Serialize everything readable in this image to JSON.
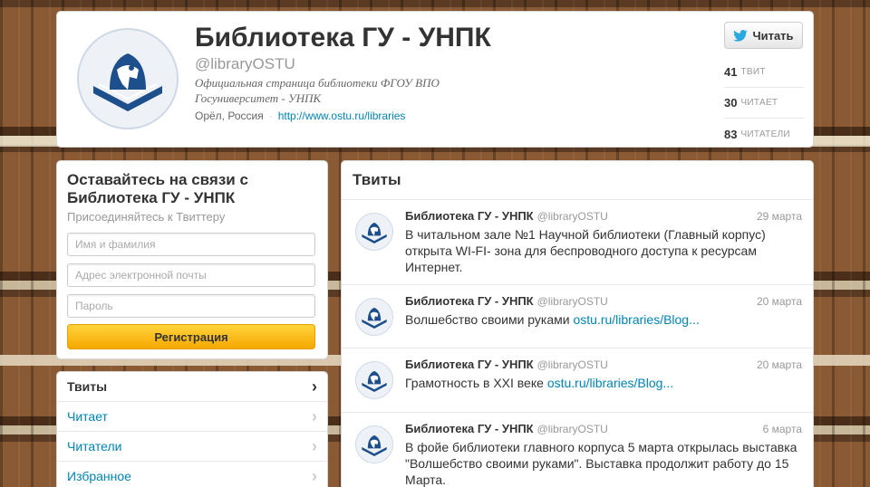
{
  "profile": {
    "name": "Библиотека ГУ - УНПК",
    "handle": "@libraryOSTU",
    "bio": "Официальная страница библиотеки ФГОУ ВПО Госуниверситет - УНПК",
    "location": "Орёл, Россия",
    "url": "http://www.ostu.ru/libraries",
    "follow_label": "Читать",
    "stats": [
      {
        "count": "41",
        "label": "твит"
      },
      {
        "count": "30",
        "label": "читает"
      },
      {
        "count": "83",
        "label": "читатели"
      }
    ]
  },
  "signup": {
    "title": "Оставайтесь на связи с Библиотека ГУ - УНПК",
    "subtitle": "Присоединяйтесь к Твиттеру",
    "name_placeholder": "Имя и фамилия",
    "email_placeholder": "Адрес электронной почты",
    "password_placeholder": "Пароль",
    "button_label": "Регистрация"
  },
  "nav": {
    "items": [
      {
        "label": "Твиты",
        "active": true
      },
      {
        "label": "Читает",
        "active": false
      },
      {
        "label": "Читатели",
        "active": false
      },
      {
        "label": "Избранное",
        "active": false
      }
    ]
  },
  "tweets": {
    "header": "Твиты",
    "items": [
      {
        "name": "Библиотека ГУ - УНПК",
        "handle": "@libraryOSTU",
        "date": "29 марта",
        "text": "В читальном зале №1 Научной библиотеки (Главный корпус) открыта WI-FI- зона для беспроводного доступа к ресурсам Интернет.",
        "link": ""
      },
      {
        "name": "Библиотека ГУ - УНПК",
        "handle": "@libraryOSTU",
        "date": "20 марта",
        "text": "Волшебство своими руками",
        "link": "ostu.ru/libraries/Blog..."
      },
      {
        "name": "Библиотека ГУ - УНПК",
        "handle": "@libraryOSTU",
        "date": "20 марта",
        "text": "Грамотность в XXI веке",
        "link": "ostu.ru/libraries/Blog..."
      },
      {
        "name": "Библиотека ГУ - УНПК",
        "handle": "@libraryOSTU",
        "date": "6 марта",
        "text": "В фойе библиотеки главного корпуса 5 марта открылась выставка \"Волшебство своими руками\". Выставка продолжит работу до 15 Марта.",
        "link": ""
      }
    ]
  },
  "colors": {
    "link": "#0084b4",
    "button_yellow": "#f6a800",
    "logo_blue": "#1d4f8c"
  }
}
